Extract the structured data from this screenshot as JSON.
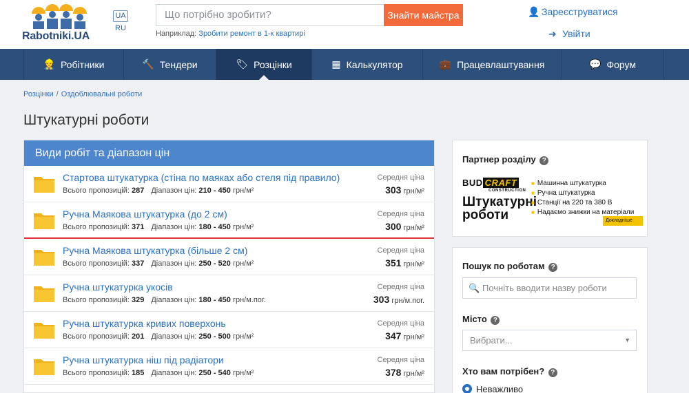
{
  "header": {
    "logo_text": "Rabotniki.UA",
    "lang_active": "UA",
    "lang_other": "RU",
    "search_placeholder": "Що потрібно зробити?",
    "search_button": "Знайти майстра",
    "hint_prefix": "Наприклад:",
    "hint_link": "Зробити ремонт в 1-к квартирі",
    "register": "Зареєструватися",
    "login": "Увійти"
  },
  "nav": [
    {
      "label": "Робітники",
      "icon": "worker-icon",
      "glyph": "👷"
    },
    {
      "label": "Тендери",
      "icon": "hammer-icon",
      "glyph": "🔨"
    },
    {
      "label": "Розцінки",
      "icon": "tags-icon",
      "glyph": "🏷"
    },
    {
      "label": "Калькулятор",
      "icon": "calculator-icon",
      "glyph": "▦"
    },
    {
      "label": "Працевлаштування",
      "icon": "briefcase-icon",
      "glyph": "💼"
    },
    {
      "label": "Форум",
      "icon": "comments-icon",
      "glyph": "💬"
    }
  ],
  "breadcrumb": [
    "Розцінки",
    "Оздоблювальні роботи"
  ],
  "page_title": "Штукатурні роботи",
  "panel": {
    "title": "Види робіт та діапазон цін",
    "offers_label": "Всього пропозицій:",
    "range_label": "Діапазон цін:",
    "avg_label": "Середня ціна",
    "rows": [
      {
        "title": "Стартова штукатурка (стіна по маяках або стеля під правило)",
        "offers": "287",
        "range": "210 - 450",
        "unit": "грн/м²",
        "avg": "303"
      },
      {
        "title": "Ручна Маякова штукатурка (до 2 см)",
        "offers": "371",
        "range": "180 - 450",
        "unit": "грн/м²",
        "avg": "300"
      },
      {
        "title": "Ручна Маякова штукатурка (більше 2 см)",
        "offers": "337",
        "range": "250 - 520",
        "unit": "грн/м²",
        "avg": "351"
      },
      {
        "title": "Ручна штукатурка укосів",
        "offers": "329",
        "range": "180 - 450",
        "unit": "грн/м.пог.",
        "avg": "303"
      },
      {
        "title": "Ручна штукатурка кривих поверхонь",
        "offers": "201",
        "range": "250 - 500",
        "unit": "грн/м²",
        "avg": "347"
      },
      {
        "title": "Ручна штукатурка ніш під радіатори",
        "offers": "185",
        "range": "250 - 540",
        "unit": "грн/м²",
        "avg": "378"
      }
    ]
  },
  "partner": {
    "title": "Партнер розділу",
    "ad_brand_a": "BUD",
    "ad_brand_b": "CRAFT",
    "ad_sub": "CONSTRUCTION",
    "ad_big_1": "Штукатурні",
    "ad_big_2": "роботи",
    "ad_items": [
      "Машинна штукатурка",
      "Ручна штукатурка",
      "Станції на 220 та 380 В",
      "Надаємо знижки на матеріали"
    ],
    "ad_more": "Докладніше"
  },
  "filters": {
    "search_title": "Пошук по роботам",
    "search_placeholder": "Почніть вводити назву роботи",
    "city_title": "Місто",
    "city_value": "Вибрати...",
    "who_title": "Хто вам потрібен?",
    "who_option": "Неважливо"
  },
  "colors": {
    "brand_blue": "#2d4f7c",
    "accent_orange": "#f26a3a",
    "panel_blue": "#4d86cc",
    "link": "#2a70c0",
    "highlight_red": "#e0303a"
  }
}
